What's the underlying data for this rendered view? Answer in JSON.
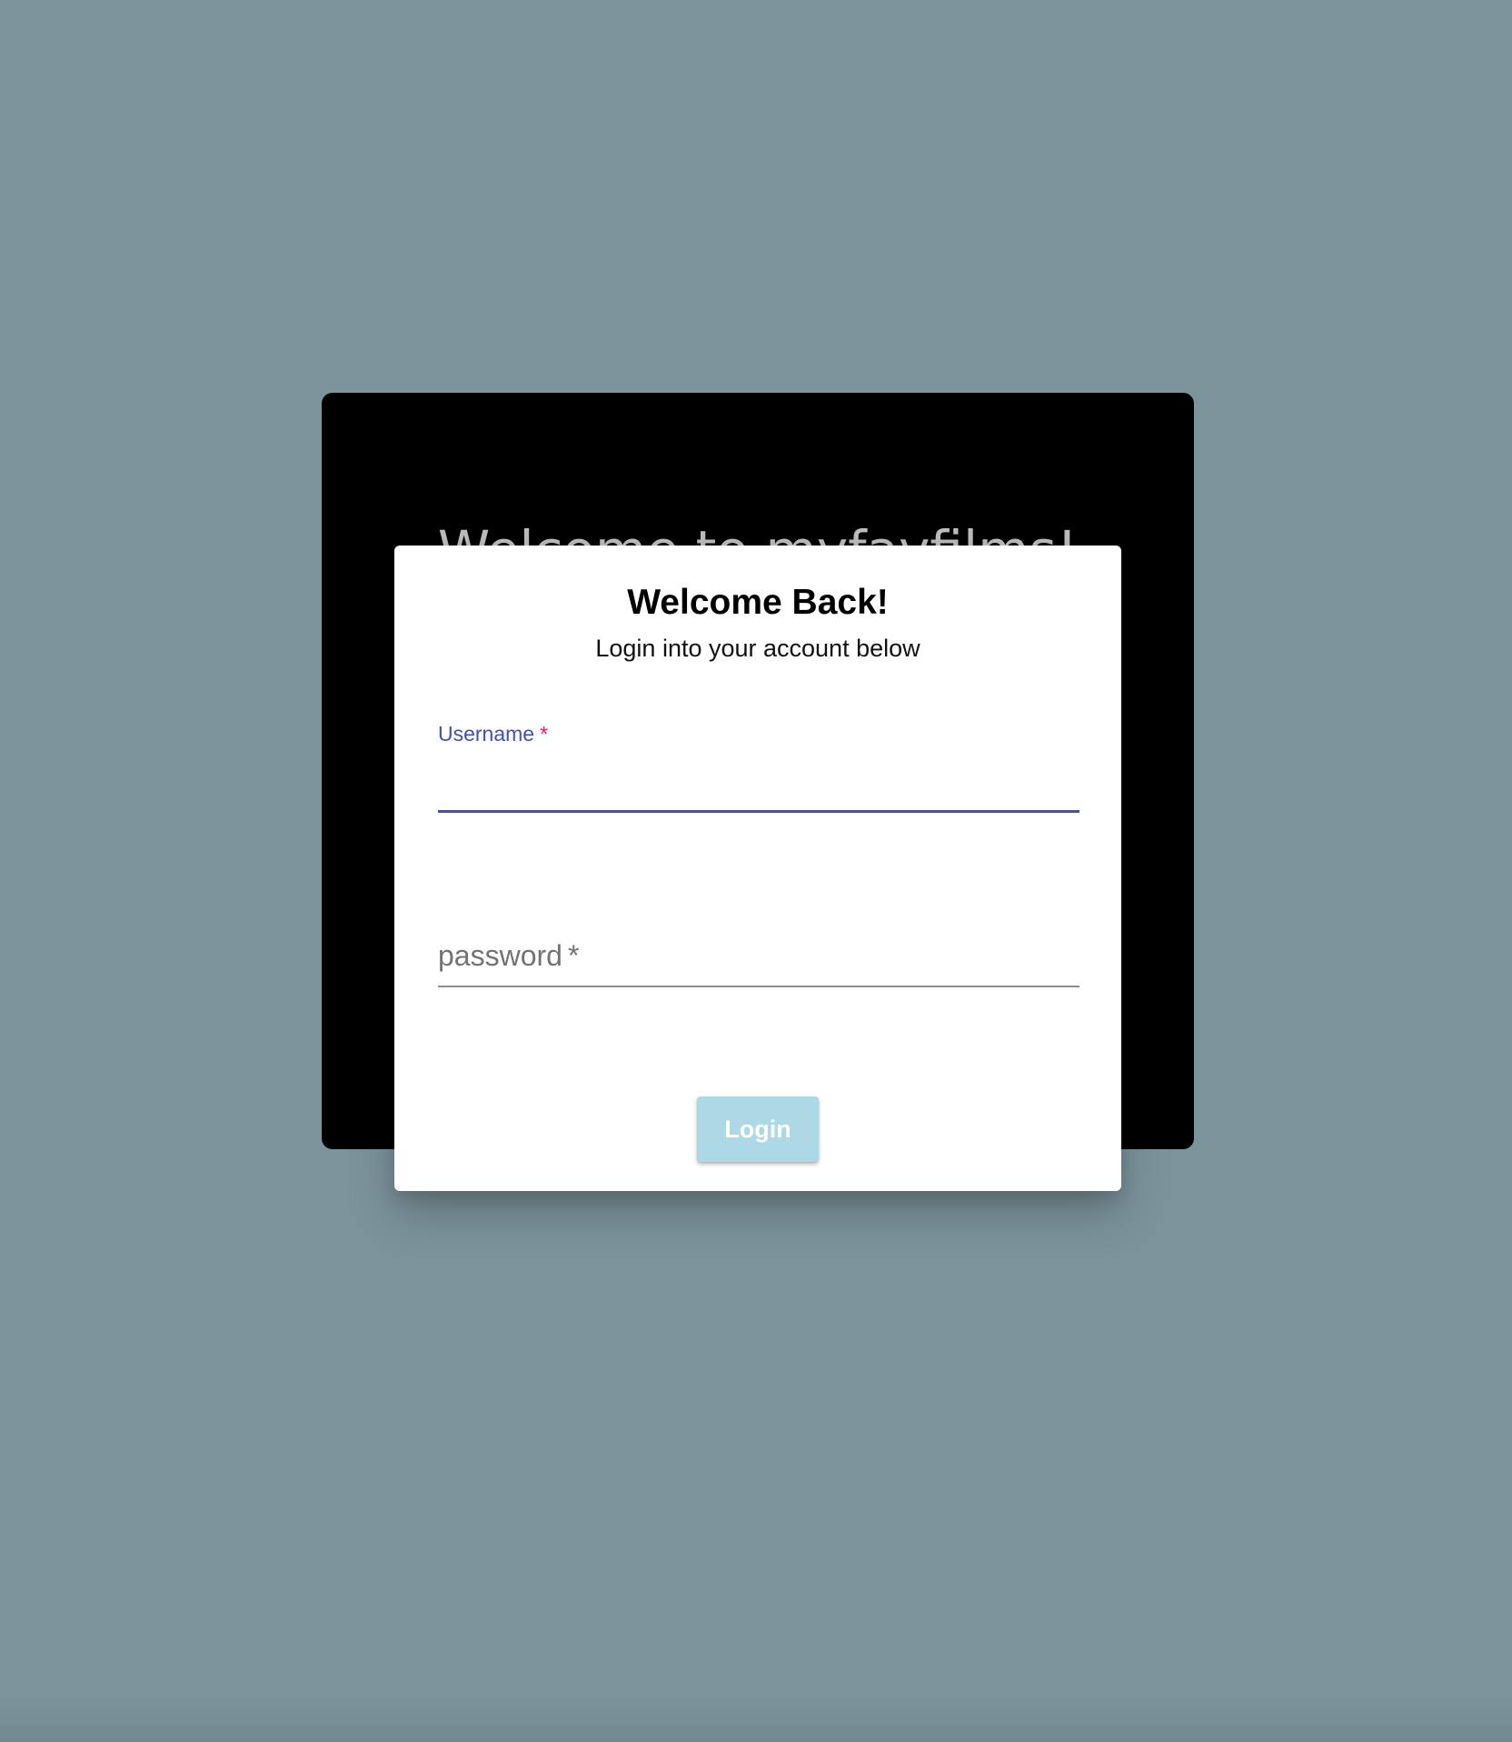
{
  "background_card": {
    "title": "Welcome to myfavfilms!"
  },
  "login_dialog": {
    "title": "Welcome Back!",
    "subtitle": "Login into your account below",
    "username_field": {
      "label": "Username",
      "required_mark": "*",
      "value": ""
    },
    "password_field": {
      "label": "password",
      "required_mark": "*",
      "value": ""
    },
    "login_button_label": "Login"
  },
  "colors": {
    "page_background": "#7b939b",
    "back_card_background": "#000000",
    "dialog_background": "#ffffff",
    "focused_field_accent": "#3f51b5",
    "required_asterisk": "#e91e63",
    "login_button_disabled": "#add8e6"
  }
}
